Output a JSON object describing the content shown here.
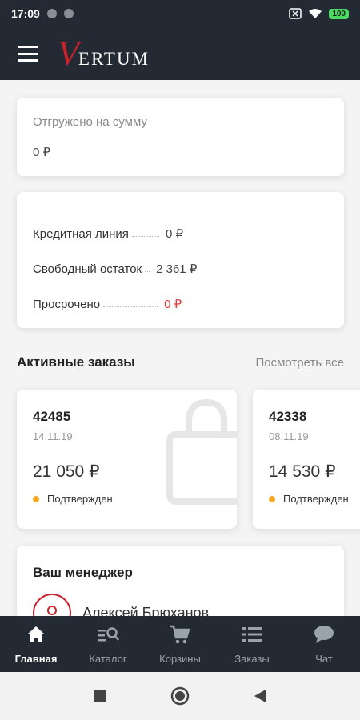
{
  "status_bar": {
    "time": "17:09",
    "battery": "100"
  },
  "app_bar": {
    "logo_v": "V",
    "logo_rest": "ERTUM"
  },
  "shipped": {
    "label": "Отгружено на сумму",
    "value": "0 ₽"
  },
  "credit": {
    "rows": [
      {
        "name": "Кредитная линия",
        "amount": "0 ₽"
      },
      {
        "name": "Свободный остаток",
        "amount": "2 361 ₽"
      },
      {
        "name": "Просрочено",
        "amount": "0 ₽"
      }
    ]
  },
  "active_orders": {
    "title": "Активные заказы",
    "view_all": "Посмотреть все",
    "orders": [
      {
        "number": "42485",
        "date": "14.11.19",
        "price": "21 050 ₽",
        "status": "Подтвержден"
      },
      {
        "number": "42338",
        "date": "08.11.19",
        "price": "14 530 ₽",
        "status": "Подтвержден"
      }
    ]
  },
  "manager": {
    "title": "Ваш менеджер",
    "name": "Алексей Брюханов"
  },
  "bottom_nav": {
    "items": [
      {
        "label": "Главная",
        "icon": "home-icon"
      },
      {
        "label": "Каталог",
        "icon": "catalog-search-icon"
      },
      {
        "label": "Корзины",
        "icon": "cart-icon"
      },
      {
        "label": "Заказы",
        "icon": "list-icon"
      },
      {
        "label": "Чат",
        "icon": "chat-icon"
      }
    ]
  },
  "colors": {
    "dark_bar": "#232a33",
    "accent_red": "#c8222e",
    "status_orange": "#f5a623",
    "overdue_red": "#e53935"
  }
}
